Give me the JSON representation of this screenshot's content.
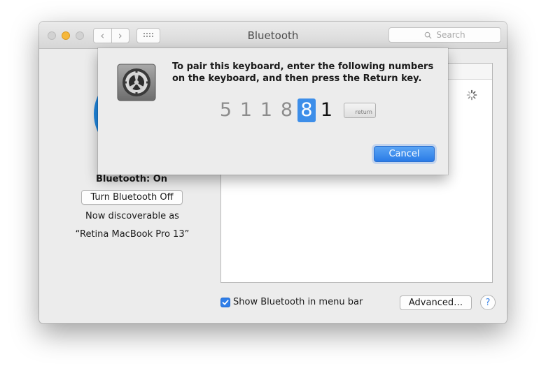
{
  "window": {
    "title": "Bluetooth",
    "search_placeholder": "Search",
    "nav_back": "‹",
    "nav_forward": "›"
  },
  "sidebar": {
    "status": "Bluetooth: On",
    "toggle_label": "Turn Bluetooth Off",
    "discoverable_text": "Now discoverable as",
    "device_name": "“Retina MacBook Pro 13”"
  },
  "footer": {
    "show_in_menu_bar_label": "Show Bluetooth in menu bar",
    "show_in_menu_bar_checked": true,
    "advanced_label": "Advanced…",
    "help_label": "?"
  },
  "sheet": {
    "message_line1": "To pair this keyboard, enter the following numbers",
    "message_line2": "on the keyboard, and then press the Return key.",
    "code_digits": [
      "5",
      "1",
      "1",
      "8",
      "8",
      "1"
    ],
    "entered_count": 4,
    "return_key_label": "return",
    "cancel_label": "Cancel"
  },
  "colors": {
    "accent": "#2f7ee8",
    "bluetooth_blue": "#1f87e0",
    "minimize_yellow": "#f6b83c"
  },
  "icons": {
    "sheet_icon": "system-preferences-gear-icon",
    "search": "magnifier-icon",
    "grid": "grid-icon",
    "spinner": "activity-spinner-icon"
  }
}
